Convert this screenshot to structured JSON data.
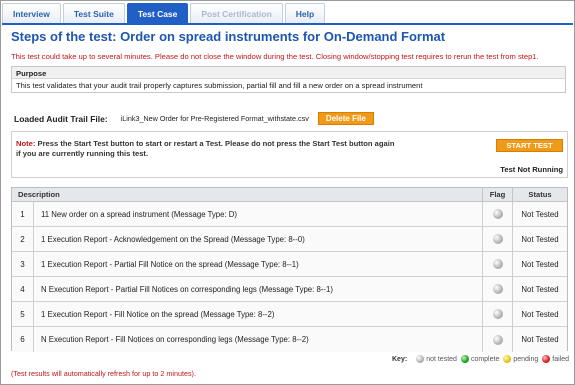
{
  "tabs": [
    {
      "label": "Interview",
      "state": "normal"
    },
    {
      "label": "Test Suite",
      "state": "normal"
    },
    {
      "label": "Test Case",
      "state": "active"
    },
    {
      "label": "Post Certification",
      "state": "disabled"
    },
    {
      "label": "Help",
      "state": "normal"
    }
  ],
  "page": {
    "title": "Steps of the test: Order on spread instruments for On-Demand Format",
    "warning": "This test could take up to several minutes. Please do not close the window during the test. Closing window/stopping test requires to rerun the test from step1."
  },
  "purpose": {
    "heading": "Purpose",
    "text": "This test validates that your audit trail properly captures submission, partial fill and fill a new order on a spread instrument"
  },
  "audit": {
    "label": "Loaded Audit Trail File:",
    "filename": "iLink3_New Order for Pre-Registered Format_withstate.csv",
    "delete_label": "Delete File"
  },
  "control": {
    "note_label": "Note:",
    "note_text": "Press the Start Test button to start or restart a Test. Please do not press the Start Test button again if you are currently running this test.",
    "start_label": "START TEST",
    "run_status": "Test Not Running"
  },
  "grid": {
    "columns": {
      "description": "Description",
      "flag": "Flag",
      "status": "Status"
    },
    "rows": [
      {
        "num": "1",
        "description": "11 New order on a spread instrument (Message Type: D)",
        "flag": "grey",
        "status": "Not Tested"
      },
      {
        "num": "2",
        "description": "1 Execution Report - Acknowledgement on the Spread (Message Type: 8--0)",
        "flag": "grey",
        "status": "Not Tested"
      },
      {
        "num": "3",
        "description": "1 Execution Report - Partial Fill Notice on the spread (Message Type: 8--1)",
        "flag": "grey",
        "status": "Not Tested"
      },
      {
        "num": "4",
        "description": "N Execution Report - Partial Fill Notices on corresponding legs (Message Type: 8--1)",
        "flag": "grey",
        "status": "Not Tested"
      },
      {
        "num": "5",
        "description": "1 Execution Report - Fill Notice on the spread (Message Type: 8--2)",
        "flag": "grey",
        "status": "Not Tested"
      },
      {
        "num": "6",
        "description": "N Execution Report - Fill Notices on corresponding legs (Message Type: 8--2)",
        "flag": "grey",
        "status": "Not Tested"
      }
    ]
  },
  "key": {
    "title": "Key:",
    "items": [
      {
        "label": "not tested",
        "color": "grey"
      },
      {
        "label": "complete",
        "color": "green"
      },
      {
        "label": "pending",
        "color": "yellow"
      },
      {
        "label": "failed",
        "color": "red"
      }
    ]
  },
  "footer": {
    "refresh_note": "(Test results will automatically refresh for up to 2 minutes)."
  },
  "colors": {
    "accent": "#1f5fc6",
    "title": "#1e56b0",
    "warning": "#c01818",
    "button": "#f09a18"
  }
}
